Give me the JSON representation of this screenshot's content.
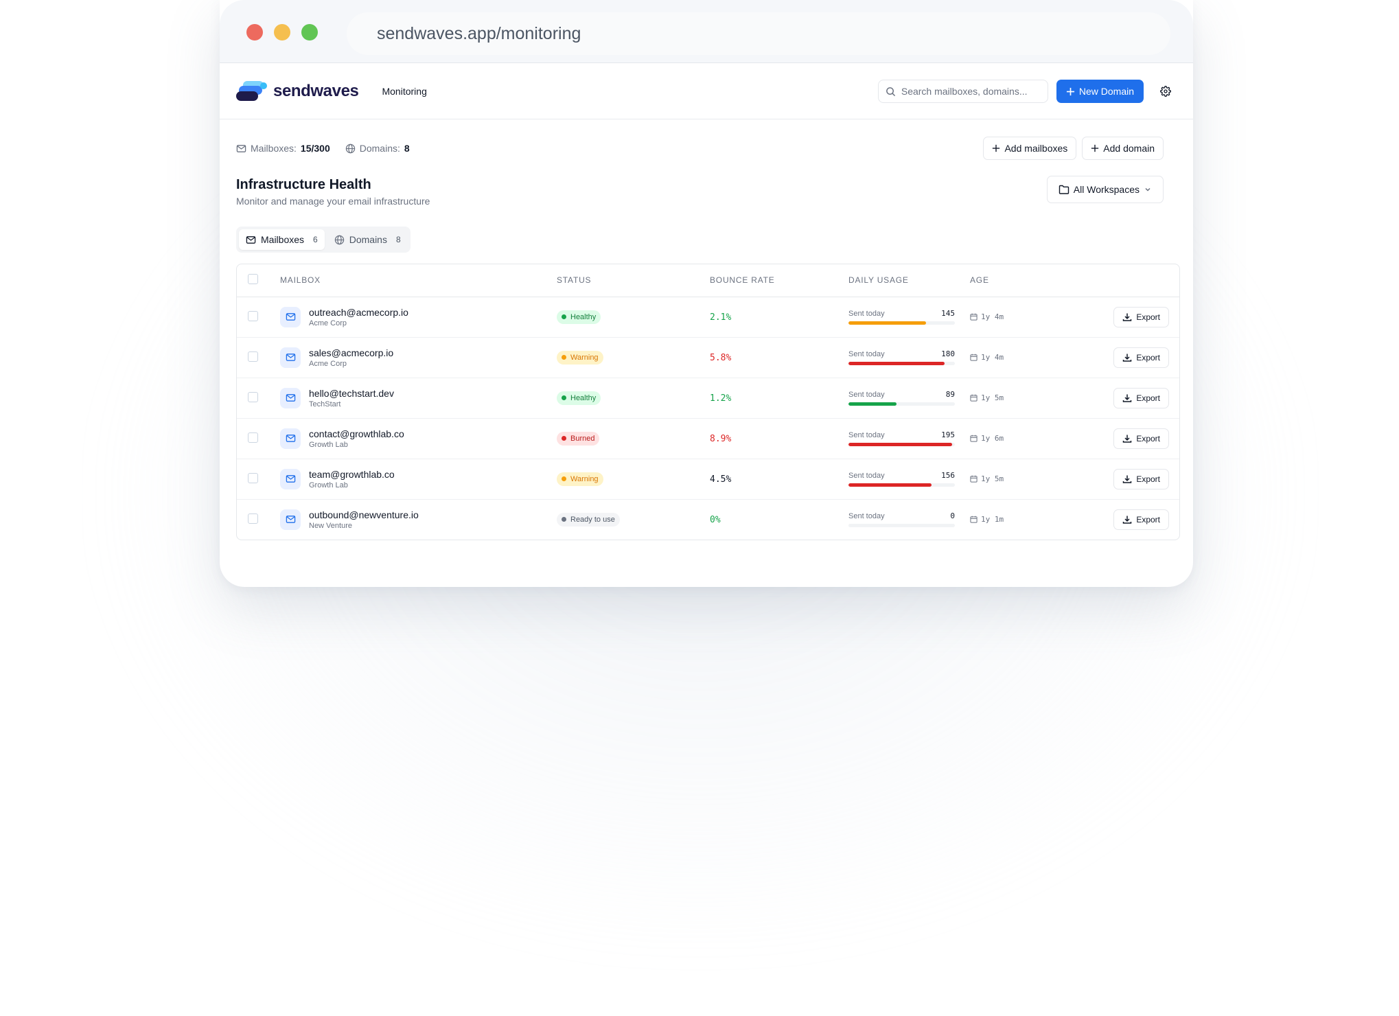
{
  "browser": {
    "url": "sendwaves.app/monitoring"
  },
  "header": {
    "logo_text": "sendwaves",
    "nav_monitoring": "Monitoring",
    "search_placeholder": "Search mailboxes, domains...",
    "new_domain_label": "New Domain",
    "accent_color": "#1f6feb"
  },
  "stats": {
    "mailboxes_label": "Mailboxes:",
    "mailboxes_value": "15/300",
    "domains_label": "Domains:",
    "domains_value": "8",
    "add_mailboxes_label": "Add mailboxes",
    "add_domain_label": "Add domain"
  },
  "page": {
    "title": "Infrastructure Health",
    "subtitle": "Monitor and manage your email infrastructure",
    "workspace_label": "All Workspaces"
  },
  "tabs": [
    {
      "label": "Mailboxes",
      "count": "6",
      "icon": "mail-icon",
      "active": true
    },
    {
      "label": "Domains",
      "count": "8",
      "icon": "globe-icon",
      "active": false
    }
  ],
  "table": {
    "columns": [
      "MAILBOX",
      "STATUS",
      "BOUNCE RATE",
      "DAILY USAGE",
      "AGE"
    ],
    "rows": [
      {
        "email": "outreach@acmecorp.io",
        "org": "Acme Corp",
        "status": "Healthy",
        "status_kind": "healthy",
        "bounce": "2.1%",
        "bounce_kind": "green",
        "usage_label": "Sent today",
        "sent": "145",
        "usage_fraction": 0.73,
        "bar_color": "#f59e0b",
        "age": "1y 4m",
        "action": "Export"
      },
      {
        "email": "sales@acmecorp.io",
        "org": "Acme Corp",
        "status": "Warning",
        "status_kind": "warning",
        "bounce": "5.8%",
        "bounce_kind": "red",
        "usage_label": "Sent today",
        "sent": "180",
        "usage_fraction": 0.9,
        "bar_color": "#dc2626",
        "age": "1y 4m",
        "action": "Export"
      },
      {
        "email": "hello@techstart.dev",
        "org": "TechStart",
        "status": "Healthy",
        "status_kind": "healthy",
        "bounce": "1.2%",
        "bounce_kind": "green",
        "usage_label": "Sent today",
        "sent": "89",
        "usage_fraction": 0.45,
        "bar_color": "#16a34a",
        "age": "1y 5m",
        "action": "Export"
      },
      {
        "email": "contact@growthlab.co",
        "org": "Growth Lab",
        "status": "Burned",
        "status_kind": "burned",
        "bounce": "8.9%",
        "bounce_kind": "red",
        "usage_label": "Sent today",
        "sent": "195",
        "usage_fraction": 0.975,
        "bar_color": "#dc2626",
        "age": "1y 6m",
        "action": "Export"
      },
      {
        "email": "team@growthlab.co",
        "org": "Growth Lab",
        "status": "Warning",
        "status_kind": "warning",
        "bounce": "4.5%",
        "bounce_kind": "dark",
        "usage_label": "Sent today",
        "sent": "156",
        "usage_fraction": 0.78,
        "bar_color": "#dc2626",
        "age": "1y 5m",
        "action": "Export"
      },
      {
        "email": "outbound@newventure.io",
        "org": "New Venture",
        "status": "Ready to use",
        "status_kind": "ready",
        "bounce": "0%",
        "bounce_kind": "green",
        "usage_label": "Sent today",
        "sent": "0",
        "usage_fraction": 0,
        "bar_color": "#16a34a",
        "age": "1y 1m",
        "action": "Export"
      }
    ]
  }
}
